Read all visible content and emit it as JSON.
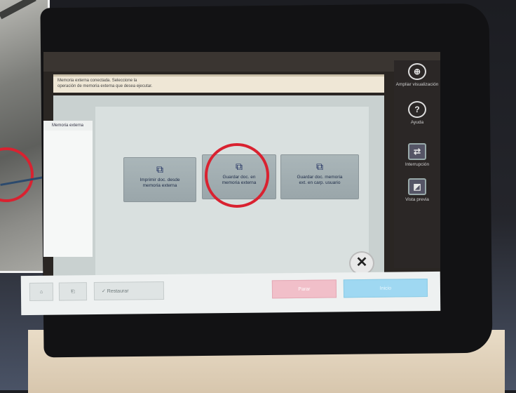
{
  "message": {
    "line1": "Memoria externa conectada. Seleccione la",
    "line2": "operación de memoria externa que desea ejecutar."
  },
  "side_tab": {
    "label": "Memoria externa"
  },
  "buttons": [
    {
      "label_line1": "Imprimir doc. desde",
      "label_line2": "memoria externa",
      "icon": "document-copy-icon"
    },
    {
      "label_line1": "Guardar doc. en",
      "label_line2": "memoria externa",
      "icon": "document-copy-icon"
    },
    {
      "label_line1": "Guardar doc. memoria",
      "label_line2": "ext. en carp. usuario",
      "icon": "document-user-icon"
    }
  ],
  "right_sidebar": [
    {
      "label": "Ampliar visualización",
      "icon": "zoom-in-icon",
      "glyph": "⊕"
    },
    {
      "label": "Ayuda",
      "icon": "help-icon",
      "glyph": "?"
    },
    {
      "label": "Interrupción",
      "icon": "interrupt-icon",
      "glyph": "⇄"
    },
    {
      "label": "Vista previa",
      "icon": "preview-icon",
      "glyph": "◩"
    }
  ],
  "bottom_bar": {
    "home_glyph": "⌂",
    "program_glyph": "⎗",
    "reset_label": "✓  Restaurar",
    "stop_label": "Parar",
    "start_label": "Inicio"
  },
  "close_glyph": "✕",
  "colors": {
    "highlight_circle": "#d92230",
    "stop_button": "#f1bfc9",
    "start_button": "#9fd8f2"
  }
}
